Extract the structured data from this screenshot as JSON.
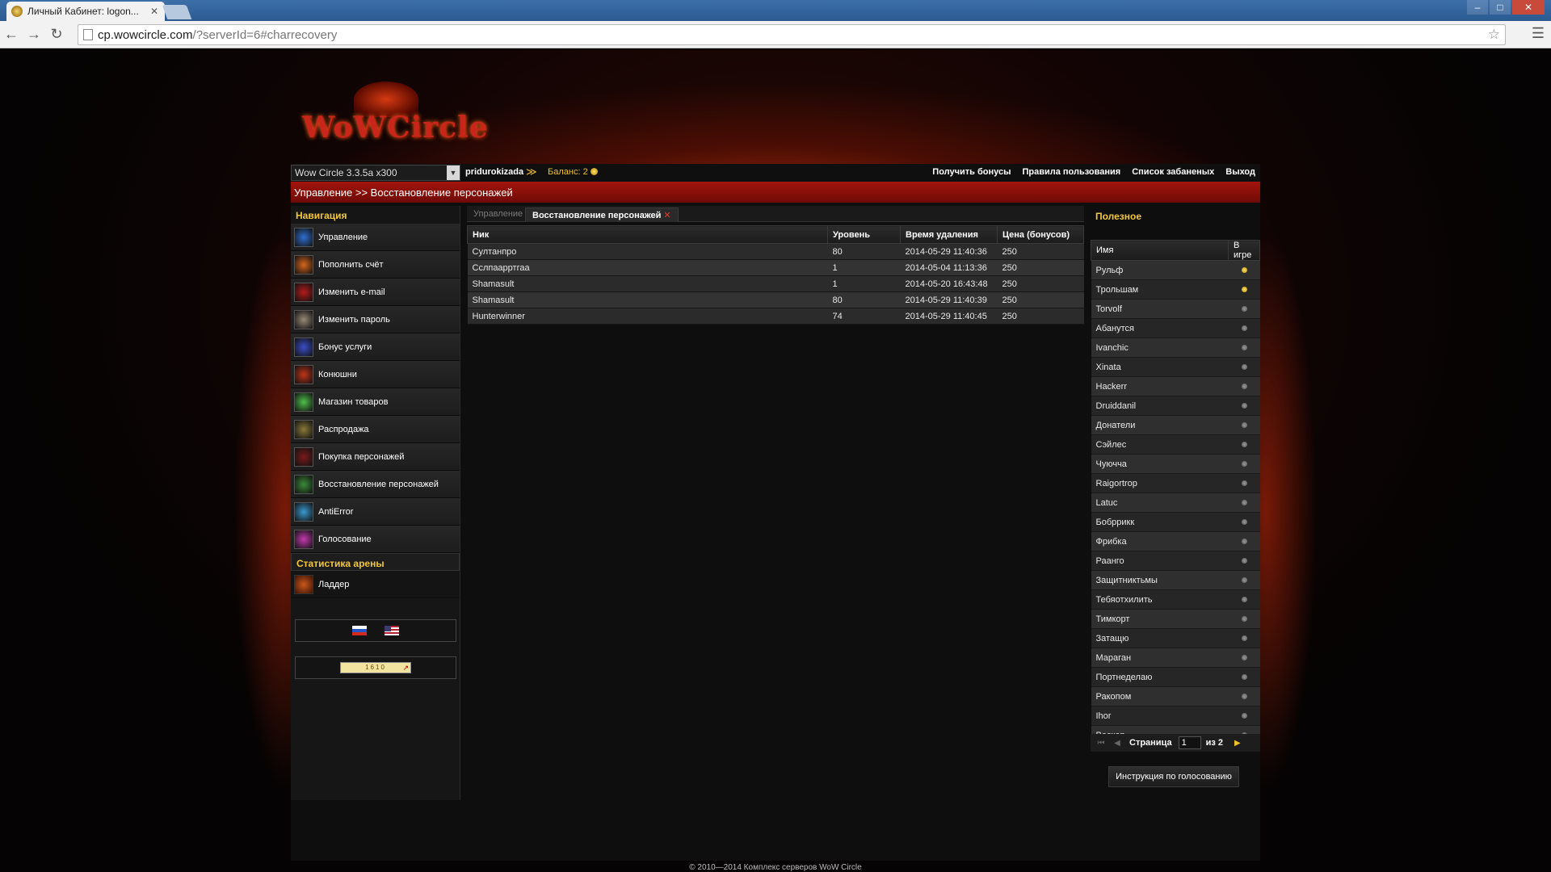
{
  "browser": {
    "tab_title": "Личный Кабинет: logon...",
    "url_host": "cp.wowcircle.com",
    "url_rest": "/?serverId=6#charrecovery"
  },
  "header": {
    "logo_text": "WoWCircle",
    "server": "Wow Circle 3.3.5a x300",
    "username": "pridurokizada",
    "balance_label": "Баланс:",
    "balance_value": "2",
    "links": [
      "Получить бонусы",
      "Правила пользования",
      "Список забаненых",
      "Выход"
    ]
  },
  "breadcrumb": "Управление >> Восстановление персонажей",
  "sidebar": {
    "nav_title": "Навигация",
    "items": [
      {
        "label": "Управление",
        "color": "#2f6fd1"
      },
      {
        "label": "Пополнить счёт",
        "color": "#d6641a"
      },
      {
        "label": "Изменить e-mail",
        "color": "#b41b1b"
      },
      {
        "label": "Изменить пароль",
        "color": "#9a8a78"
      },
      {
        "label": "Бонус услуги",
        "color": "#3a4ec8"
      },
      {
        "label": "Конюшни",
        "color": "#c0341a"
      },
      {
        "label": "Магазин товаров",
        "color": "#4fbf4a"
      },
      {
        "label": "Распродажа",
        "color": "#8a7a3a"
      },
      {
        "label": "Покупка персонажей",
        "color": "#7a1a1a"
      },
      {
        "label": "Восстановление персонажей",
        "color": "#3a8a3a"
      },
      {
        "label": "AntiError",
        "color": "#3a9ad1"
      },
      {
        "label": "Голосование",
        "color": "#c43ab0"
      }
    ],
    "arena_title": "Статистика арены",
    "ladder": "Ладдер",
    "counter": "1610"
  },
  "center": {
    "tabs": [
      "Управление",
      "Восстановление персонажей"
    ],
    "columns": [
      "Ник",
      "Уровень",
      "Время удаления",
      "Цена (бонусов)"
    ],
    "rows": [
      [
        "Султанпро",
        "80",
        "2014-05-29 11:40:36",
        "250"
      ],
      [
        "Сслпаарртгаа",
        "1",
        "2014-05-04 11:13:36",
        "250"
      ],
      [
        "Shamasult",
        "1",
        "2014-05-20 16:43:48",
        "250"
      ],
      [
        "Shamasult",
        "80",
        "2014-05-29 11:40:39",
        "250"
      ],
      [
        "Hunterwinner",
        "74",
        "2014-05-29 11:40:45",
        "250"
      ]
    ]
  },
  "right": {
    "title": "Полезное",
    "columns": [
      "Имя",
      "В игре"
    ],
    "users": [
      {
        "name": "Рульф",
        "online": true
      },
      {
        "name": "Трольшам",
        "online": true
      },
      {
        "name": "Torvolf",
        "online": false
      },
      {
        "name": "Абанутся",
        "online": false
      },
      {
        "name": "Ivanchic",
        "online": false
      },
      {
        "name": "Xinata",
        "online": false
      },
      {
        "name": "Hackerr",
        "online": false
      },
      {
        "name": "Druiddanil",
        "online": false
      },
      {
        "name": "Донатели",
        "online": false
      },
      {
        "name": "Сэйлес",
        "online": false
      },
      {
        "name": "Чуючча",
        "online": false
      },
      {
        "name": "Raigortrop",
        "online": false
      },
      {
        "name": "Latuc",
        "online": false
      },
      {
        "name": "Бобррикк",
        "online": false
      },
      {
        "name": "Фрибка",
        "online": false
      },
      {
        "name": "Раанго",
        "online": false
      },
      {
        "name": "Защитниктьмы",
        "online": false
      },
      {
        "name": "Тебяотхилить",
        "online": false
      },
      {
        "name": "Тимкорт",
        "online": false
      },
      {
        "name": "Затащю",
        "online": false
      },
      {
        "name": "Мараган",
        "online": false
      },
      {
        "name": "Портнеделаю",
        "online": false
      },
      {
        "name": "Ракопом",
        "online": false
      },
      {
        "name": "Ihor",
        "online": false
      },
      {
        "name": "Вескер",
        "online": false
      }
    ],
    "pager": {
      "label": "Страница",
      "page": "1",
      "of": "из 2"
    },
    "vote_button": "Инструкция по голосованию"
  },
  "footer": "© 2010—2014 Комплекс серверов WoW Circle"
}
